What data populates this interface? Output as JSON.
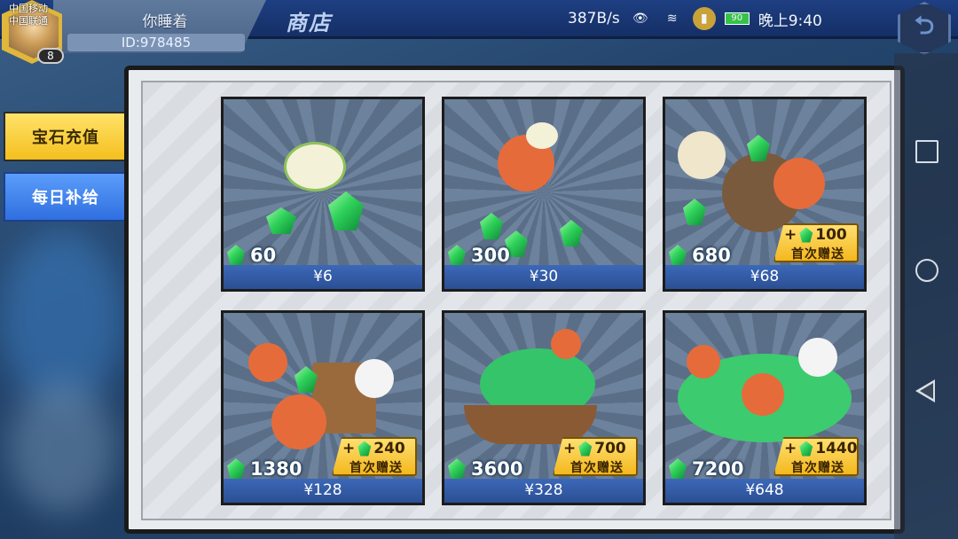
{
  "status_bar": {
    "carrier_1": "中国移动",
    "carrier_2": "中国联通",
    "network_speed": "387B/s",
    "battery": "90",
    "time": "晚上9:40"
  },
  "player": {
    "name": "你睡着",
    "id": "ID:978485",
    "level": "8"
  },
  "header": {
    "title": "商店"
  },
  "tabs": [
    {
      "label": "宝石充值",
      "active": true
    },
    {
      "label": "每日补给",
      "active": false
    }
  ],
  "products": [
    {
      "gems": "60",
      "price": "¥6",
      "bonus": null
    },
    {
      "gems": "300",
      "price": "¥30",
      "bonus": null
    },
    {
      "gems": "680",
      "price": "¥68",
      "bonus": {
        "amount": "100",
        "label": "首次赠送"
      }
    },
    {
      "gems": "1380",
      "price": "¥128",
      "bonus": {
        "amount": "240",
        "label": "首次赠送"
      }
    },
    {
      "gems": "3600",
      "price": "¥328",
      "bonus": {
        "amount": "700",
        "label": "首次赠送"
      }
    },
    {
      "gems": "7200",
      "price": "¥648",
      "bonus": {
        "amount": "1440",
        "label": "首次赠送"
      }
    }
  ],
  "bonus_prefix": "+",
  "icons": {
    "gem": "green-gem-icon",
    "back": "return-arrow-icon"
  },
  "colors": {
    "active_tab": "#f4bf1e",
    "inactive_tab": "#2f6fe0",
    "price_bar": "#2b4f93",
    "gem": "#2fd25a"
  }
}
